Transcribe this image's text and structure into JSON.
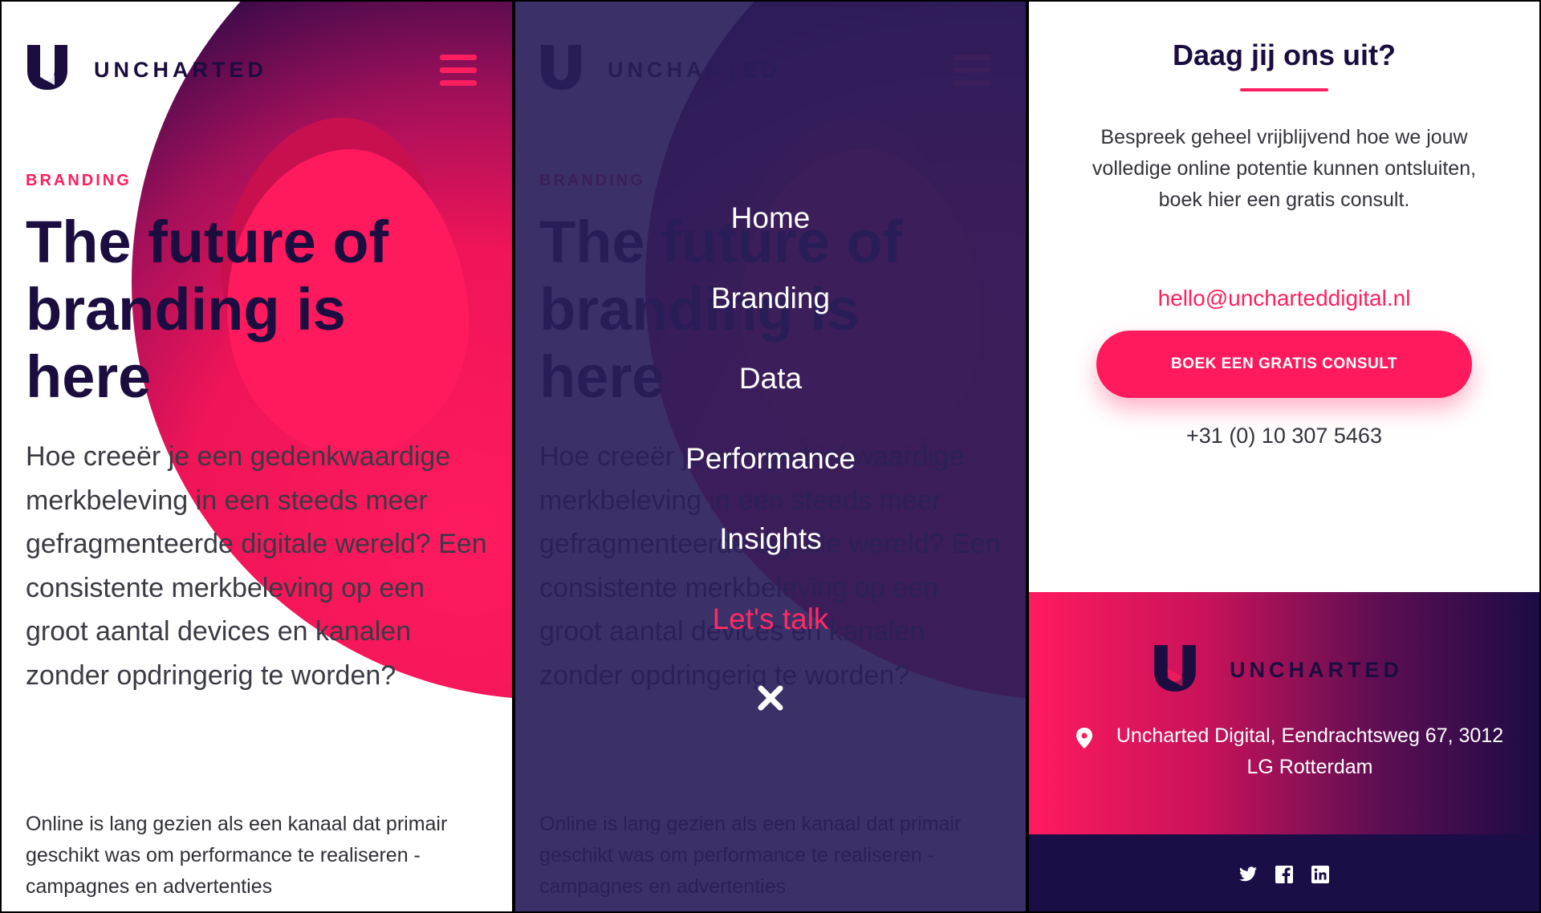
{
  "brand": {
    "name": "UNCHARTED",
    "colors": {
      "navy": "#1b0d3f",
      "pink": "#ff1f5e",
      "white": "#ffffff"
    }
  },
  "hero": {
    "category": "BRANDING",
    "headline": "The future of branding is here",
    "lead": "Hoe creeër je een gedenkwaardige merkbeleving in een steeds meer gefragmenteerde digitale wereld? Een consistente merkbeleving op een groot aantal devices en kanalen zonder opdringerig te worden?",
    "body": "Online is lang gezien als een kanaal dat primair geschikt was om performance te realiseren - campagnes en advertenties"
  },
  "menu": {
    "items": [
      {
        "label": "Home"
      },
      {
        "label": "Branding"
      },
      {
        "label": "Data"
      },
      {
        "label": "Performance"
      },
      {
        "label": "Insights"
      },
      {
        "label": "Let's talk"
      }
    ],
    "close_icon": "close-icon"
  },
  "contact": {
    "title": "Daag jij ons uit?",
    "text": "Bespreek geheel vrijblijvend hoe we jouw volledige online potentie kunnen ontsluiten, boek hier een gratis consult.",
    "email": "hello@uncharteddigital.nl",
    "button_label": "BOEK EEN GRATIS CONSULT",
    "phone": "+31 (0) 10 307 5463"
  },
  "footer": {
    "brand": "UNCHARTED",
    "address": "Uncharted Digital, Eendrachtsweg 67, 3012 LG Rotterdam",
    "social_icons": [
      "twitter-icon",
      "facebook-icon",
      "linkedin-icon"
    ]
  }
}
